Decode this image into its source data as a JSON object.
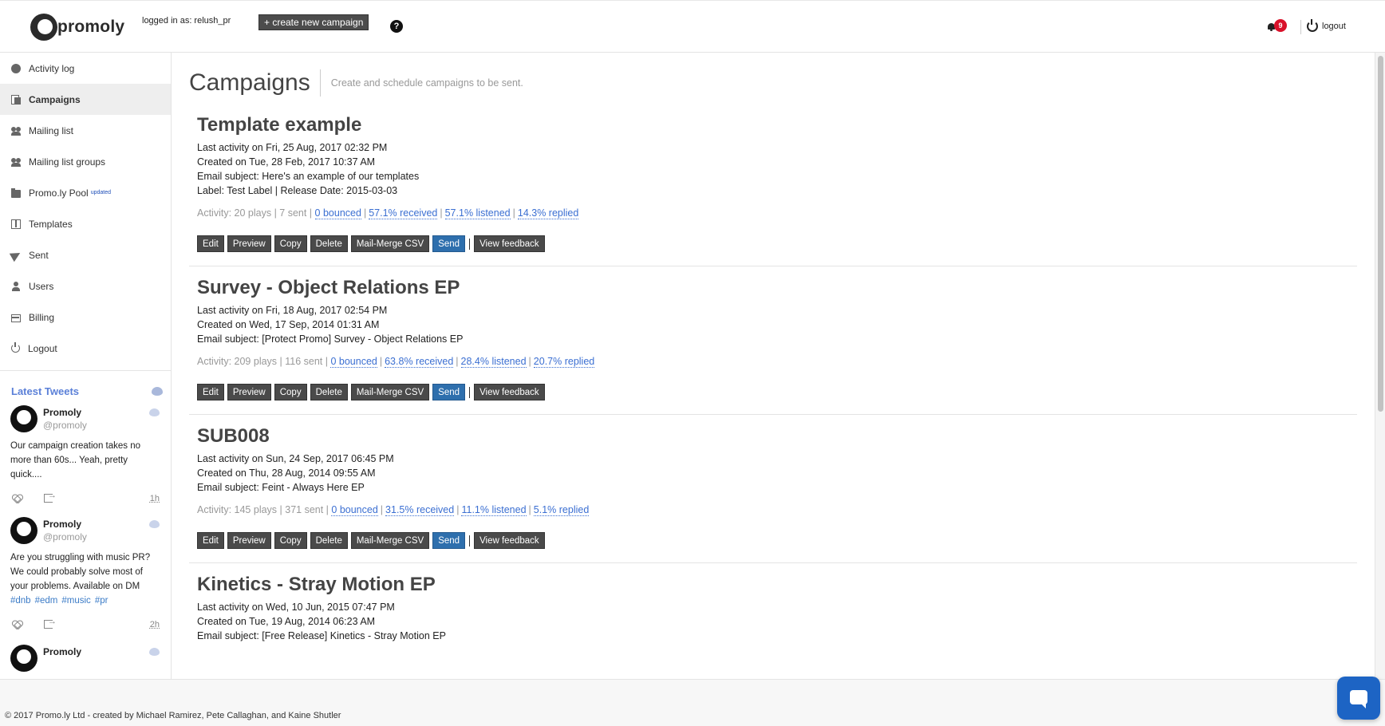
{
  "header": {
    "logo_text": "promoly",
    "logged_in": "logged in as: relush_pr",
    "create_button": "+ create new campaign",
    "help": "?",
    "notif_count": "9",
    "logout": "logout"
  },
  "sidebar": {
    "items": [
      {
        "label": "Activity log",
        "icon": "circle-icon"
      },
      {
        "label": "Campaigns",
        "icon": "files-icon"
      },
      {
        "label": "Mailing list",
        "icon": "users-icon"
      },
      {
        "label": "Mailing list groups",
        "icon": "users-icon"
      },
      {
        "label": "Promo.ly Pool",
        "icon": "folder-icon",
        "tag": "updated"
      },
      {
        "label": "Templates",
        "icon": "columns-icon"
      },
      {
        "label": "Sent",
        "icon": "paper-plane-icon"
      },
      {
        "label": "Users",
        "icon": "user-icon"
      },
      {
        "label": "Billing",
        "icon": "credit-card-icon"
      },
      {
        "label": "Logout",
        "icon": "power-icon"
      }
    ],
    "active": "Campaigns"
  },
  "tweets": {
    "title": "Latest Tweets",
    "items": [
      {
        "name": "Promoly",
        "handle": "@promoly",
        "text": "Our campaign creation takes no more than 60s... Yeah, pretty quick....",
        "tags": [],
        "time": "1h"
      },
      {
        "name": "Promoly",
        "handle": "@promoly",
        "text": "Are you struggling with music PR? We could probably solve most of your problems. Available on DM",
        "tags": [
          "#dnb",
          "#edm",
          "#music",
          "#pr"
        ],
        "time": "2h"
      },
      {
        "name": "Promoly"
      }
    ]
  },
  "main": {
    "title": "Campaigns",
    "subtitle": "Create and schedule campaigns to be sent.",
    "buttons": {
      "edit": "Edit",
      "preview": "Preview",
      "copy": "Copy",
      "delete": "Delete",
      "mailmerge": "Mail-Merge CSV",
      "send": "Send",
      "feedback": "View feedback"
    },
    "campaigns": [
      {
        "title": "Template example",
        "last_activity": "Last activity on Fri, 25 Aug, 2017 02:32 PM",
        "created": "Created on Tue, 28 Feb, 2017 10:37 AM",
        "subject": "Email subject: Here's an example of our templates",
        "label": "Label: Test Label | Release Date: 2015-03-03",
        "activity_prefix": "Activity: 20 plays | 7 sent |",
        "bounced": "0 bounced",
        "received": "57.1% received",
        "listened": "57.1% listened",
        "replied": "14.3% replied"
      },
      {
        "title": "Survey - Object Relations EP",
        "last_activity": "Last activity on Fri, 18 Aug, 2017 02:54 PM",
        "created": "Created on Wed, 17 Sep, 2014 01:31 AM",
        "subject": "Email subject: [Protect Promo] Survey - Object Relations EP",
        "activity_prefix": "Activity: 209 plays | 116 sent |",
        "bounced": "0 bounced",
        "received": "63.8% received",
        "listened": "28.4% listened",
        "replied": "20.7% replied"
      },
      {
        "title": "SUB008",
        "last_activity": "Last activity on Sun, 24 Sep, 2017 06:45 PM",
        "created": "Created on Thu, 28 Aug, 2014 09:55 AM",
        "subject": "Email subject: Feint - Always Here EP",
        "activity_prefix": "Activity: 145 plays | 371 sent |",
        "bounced": "0 bounced",
        "received": "31.5% received",
        "listened": "11.1% listened",
        "replied": "5.1% replied"
      },
      {
        "title": "Kinetics - Stray Motion EP",
        "last_activity": "Last activity on Wed, 10 Jun, 2015 07:47 PM",
        "created": "Created on Tue, 19 Aug, 2014 06:23 AM",
        "subject": "Email subject: [Free Release] Kinetics - Stray Motion EP"
      }
    ]
  },
  "footer": {
    "text": "© 2017 Promo.ly Ltd - created by Michael Ramirez, Pete Callaghan, and Kaine Shutler"
  }
}
